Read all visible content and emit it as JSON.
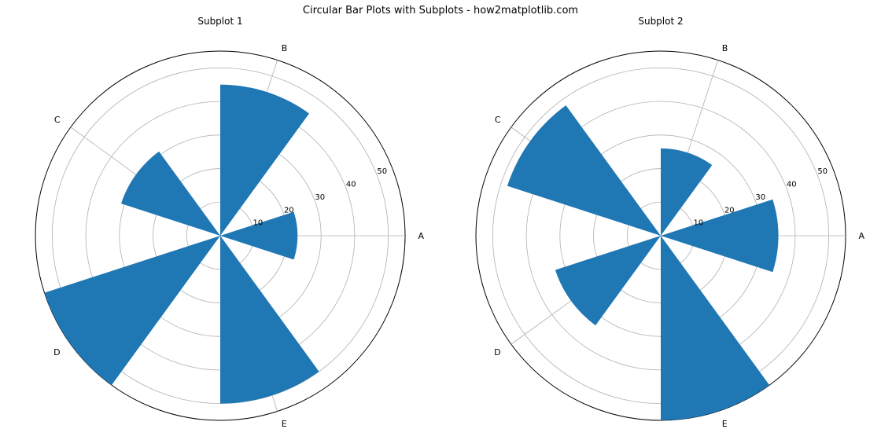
{
  "suptitle": "Circular Bar Plots with Subplots - how2matplotlib.com",
  "subplots": [
    {
      "title": "Subplot 1"
    },
    {
      "title": "Subplot 2"
    }
  ],
  "chart_data": [
    {
      "type": "bar",
      "polar": true,
      "title": "Subplot 1",
      "categories": [
        "A",
        "B",
        "C",
        "D",
        "E"
      ],
      "values": [
        23,
        45,
        31,
        55,
        50
      ],
      "rmax": 55,
      "rticks": [
        10,
        20,
        30,
        40,
        50
      ],
      "bar_color": "#1f77b4"
    },
    {
      "type": "bar",
      "polar": true,
      "title": "Subplot 2",
      "categories": [
        "A",
        "B",
        "C",
        "D",
        "E"
      ],
      "values": [
        35,
        26,
        48,
        33,
        55
      ],
      "rmax": 55,
      "rticks": [
        10,
        20,
        30,
        40,
        50
      ],
      "bar_color": "#1f77b4"
    }
  ]
}
